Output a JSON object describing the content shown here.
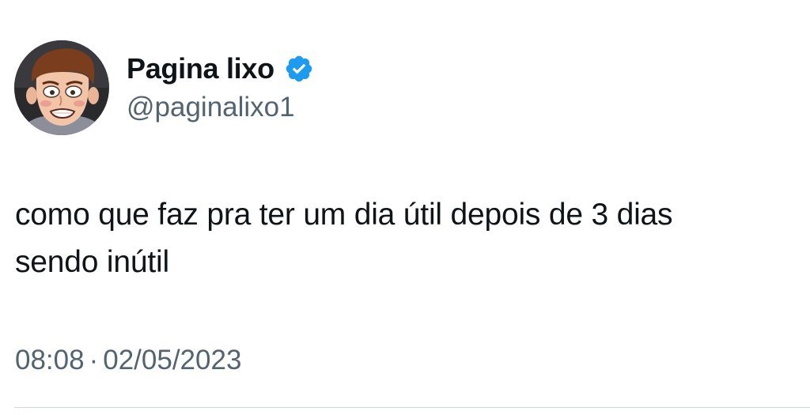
{
  "author": {
    "display_name": "Pagina lixo",
    "handle": "@paginalixo1",
    "verified_icon": "verified-badge-icon",
    "badge_color": "#1d9bf0"
  },
  "tweet": {
    "text_line_1": "como que faz pra ter um dia útil depois de 3 dias",
    "text_line_2": "sendo inútil"
  },
  "meta": {
    "time": "08:08",
    "separator": "·",
    "date": "02/05/2023"
  },
  "colors": {
    "text_primary": "#0f1419",
    "text_secondary": "#536471",
    "divider": "#cfd9de"
  }
}
